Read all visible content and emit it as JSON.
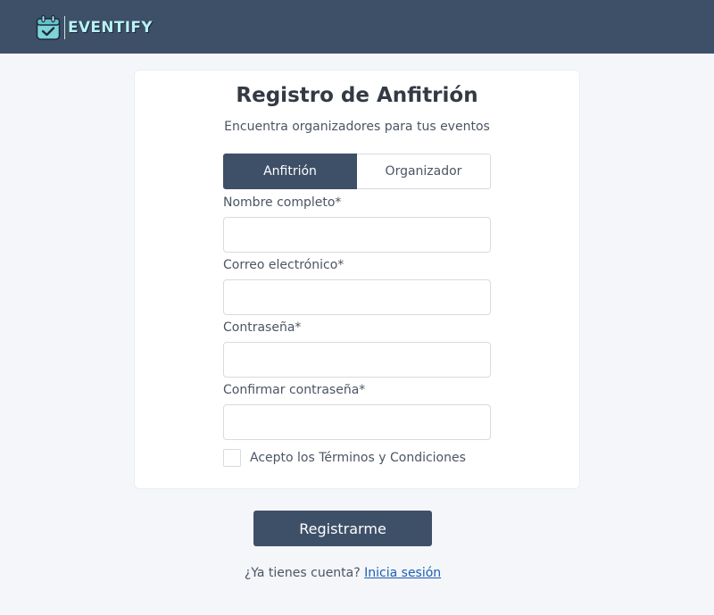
{
  "header": {
    "brand": "EVENTIFY",
    "logo_icon": "calendar-check-icon",
    "background": "#3e4f68"
  },
  "form": {
    "title": "Registro de Anfitrión",
    "subtitle": "Encuentra organizadores para tus eventos",
    "roles": [
      {
        "label": "Anfitrión",
        "selected": true
      },
      {
        "label": "Organizador",
        "selected": false
      }
    ],
    "fields": [
      {
        "label": "Nombre completo*",
        "value": "",
        "placeholder": ""
      },
      {
        "label": "Correo electrónico*",
        "value": "",
        "placeholder": ""
      },
      {
        "label": "Contraseña*",
        "value": "",
        "placeholder": ""
      },
      {
        "label": "Confirmar contraseña*",
        "value": "",
        "placeholder": ""
      }
    ],
    "terms_label": "Acepto los Términos y Condiciones",
    "terms_checked": false,
    "submit_label": "Registrarme"
  },
  "footer": {
    "prompt": "¿Ya tienes cuenta?",
    "login_link": "Inicia sesión",
    "link_color": "#1d5fb0"
  },
  "colors": {
    "primary": "#3e4f68",
    "page_bg": "#f4f6fa",
    "card_bg": "#ffffff"
  }
}
